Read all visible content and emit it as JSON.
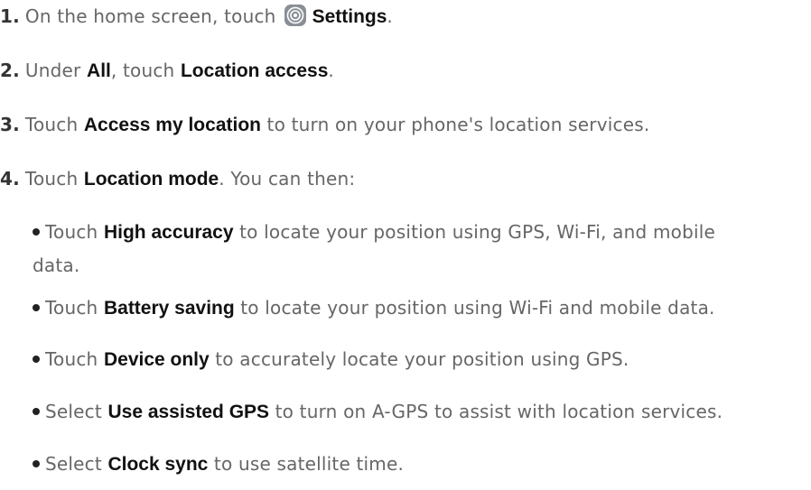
{
  "steps": [
    {
      "num": "1.",
      "pre": "On the home screen, touch",
      "icon": "settings-gear-icon",
      "bold": "Settings",
      "post": "."
    },
    {
      "num": "2.",
      "pre": "Under ",
      "bold1": "All",
      "mid": ", touch ",
      "bold2": "Location access",
      "post": "."
    },
    {
      "num": "3.",
      "pre": "Touch ",
      "bold": "Access my location",
      "post": " to turn on your phone's location services."
    },
    {
      "num": "4.",
      "pre": "Touch ",
      "bold": "Location mode",
      "post": ". You can then:"
    }
  ],
  "bullets": [
    {
      "pre": "Touch ",
      "bold": "High accuracy",
      "post": " to locate your position using GPS, Wi-Fi, and mobile",
      "cont": "data."
    },
    {
      "pre": "Touch ",
      "bold": "Battery saving",
      "post": " to locate your position using Wi-Fi and mobile data."
    },
    {
      "pre": "Touch ",
      "bold": "Device only",
      "post": " to accurately locate your position using GPS."
    },
    {
      "pre": "Select ",
      "bold": "Use assisted GPS",
      "post": " to turn on A-GPS to assist with location services."
    },
    {
      "pre": "Select ",
      "bold": "Clock sync",
      "post": " to use satellite time."
    }
  ],
  "colors": {
    "body_text": "#666666",
    "bold_text": "#111111",
    "icon_fill": "#8a8f96"
  }
}
